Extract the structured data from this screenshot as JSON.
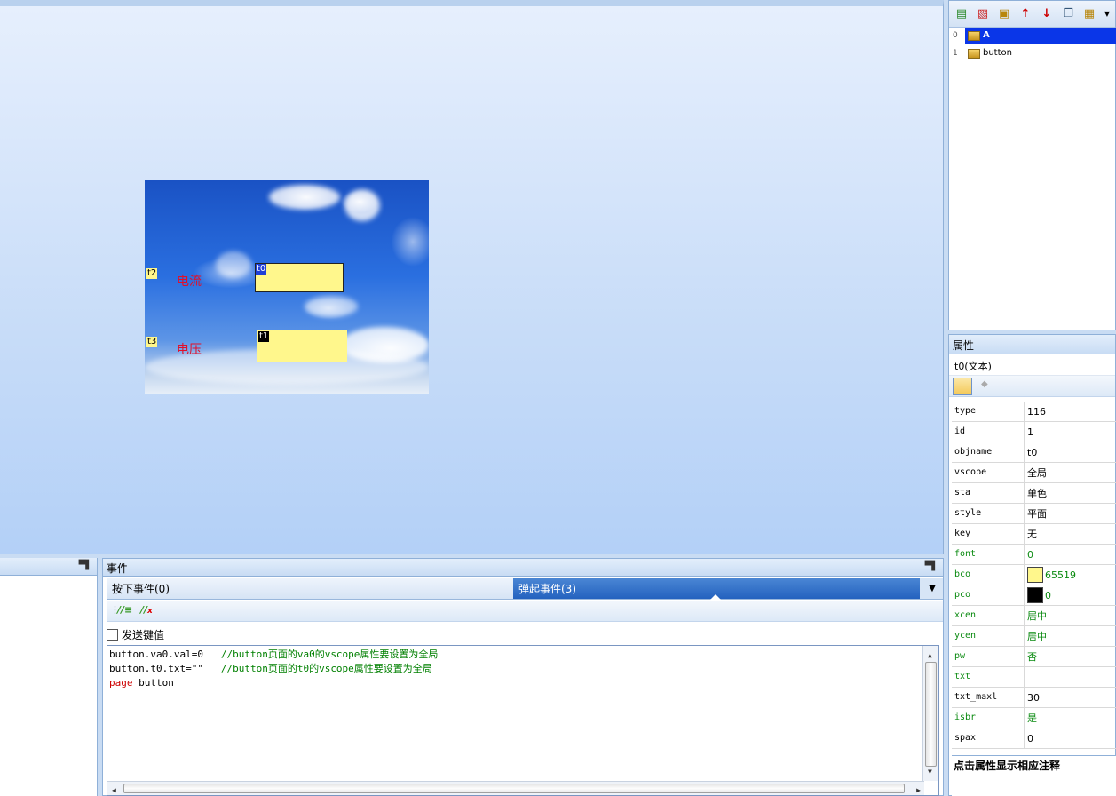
{
  "canvas": {
    "screen": {
      "tags": {
        "t2": "t2",
        "t3": "t3",
        "t0": "t0",
        "t1": "t1"
      },
      "label_current": "电流",
      "label_voltage": "电压"
    }
  },
  "event_panel": {
    "title": "事件",
    "tab_press": "按下事件(0)",
    "tab_release": "弹起事件(3)",
    "send_key_label": "发送键值",
    "code_lines": [
      {
        "code": "button.va0.val=0   ",
        "comment": "//button页面的va0的vscope属性要设置为全局"
      },
      {
        "code": "button.t0.txt=\"\"   ",
        "comment": "//button页面的t0的vscope属性要设置为全局"
      },
      {
        "keyword": "page",
        "code": " button",
        "comment": ""
      }
    ]
  },
  "pages": [
    {
      "index": "0",
      "name": "A",
      "selected": true
    },
    {
      "index": "1",
      "name": "button",
      "selected": false
    }
  ],
  "properties": {
    "title": "属性",
    "object": "t0(文本)",
    "rows": [
      {
        "name": "type",
        "value": "116",
        "green": false
      },
      {
        "name": "id",
        "value": "1",
        "green": false
      },
      {
        "name": "objname",
        "value": "t0",
        "green": false
      },
      {
        "name": "vscope",
        "value": "全局",
        "green": false
      },
      {
        "name": "sta",
        "value": "单色",
        "green": false
      },
      {
        "name": "style",
        "value": "平面",
        "green": false
      },
      {
        "name": "key",
        "value": "无",
        "green": false
      },
      {
        "name": "font",
        "value": "0",
        "green": true
      },
      {
        "name": "bco",
        "value": "65519",
        "green": true,
        "swatch": "#fff78c"
      },
      {
        "name": "pco",
        "value": "0",
        "green": true,
        "swatch": "#000000"
      },
      {
        "name": "xcen",
        "value": "居中",
        "green": true
      },
      {
        "name": "ycen",
        "value": "居中",
        "green": true
      },
      {
        "name": "pw",
        "value": "否",
        "green": true
      },
      {
        "name": "txt",
        "value": "",
        "green": true
      },
      {
        "name": "txt_maxl",
        "value": "30",
        "green": false
      },
      {
        "name": "isbr",
        "value": "是",
        "green": true
      },
      {
        "name": "spax",
        "value": "0",
        "green": false
      }
    ],
    "hint": "点击属性显示相应注释"
  },
  "colors": {
    "accent": "#2462bf",
    "selection": "#0a36e8",
    "hmi_box": "#fff78c",
    "label_red": "#e0102a"
  }
}
